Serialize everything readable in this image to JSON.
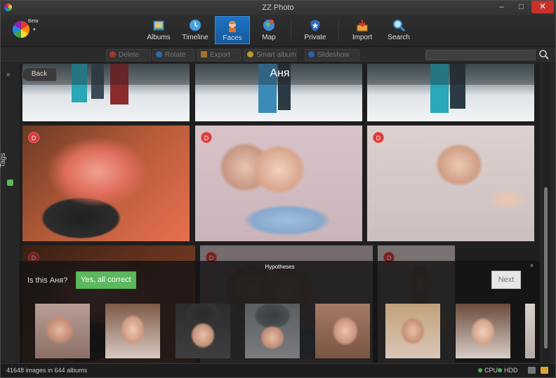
{
  "window": {
    "title": "ZZ Photo",
    "minimize_glyph": "–",
    "maximize_glyph": "□",
    "close_glyph": "✕"
  },
  "logo": {
    "badge": "Beta",
    "caret": "▾"
  },
  "nav": [
    {
      "label": "Albums",
      "icon": "albums-icon"
    },
    {
      "label": "Timeline",
      "icon": "timeline-icon"
    },
    {
      "label": "Faces",
      "icon": "faces-icon",
      "active": true
    },
    {
      "label": "Map",
      "icon": "map-icon"
    },
    {
      "label": "Private",
      "icon": "private-icon"
    },
    {
      "label": "Import",
      "icon": "import-icon"
    },
    {
      "label": "Search",
      "icon": "search-icon"
    }
  ],
  "actions": [
    {
      "label": "Delete",
      "icon": "delete-icon",
      "color": "#c0392b"
    },
    {
      "label": "Rotate",
      "icon": "rotate-icon",
      "color": "#2a7bc0"
    },
    {
      "label": "Export",
      "icon": "export-icon",
      "color": "#c07a2a"
    },
    {
      "label": "Smart album",
      "icon": "smart-album-icon",
      "color": "#c8a12a"
    },
    {
      "label": "Slideshow",
      "icon": "slideshow-icon",
      "color": "#2a6bc0"
    }
  ],
  "search": {
    "placeholder": ""
  },
  "sidebar": {
    "tags_label": "Tags",
    "expand_glyph": "»"
  },
  "view": {
    "back_label": "Back",
    "person_name": "Аня",
    "badge_letter": "D"
  },
  "hypotheses": {
    "title": "Hypotheses",
    "collapse_glyph": "»",
    "question": "Is this Аня?",
    "confirm_label": "Yes, all correct",
    "next_label": "Next"
  },
  "status": {
    "summary": "41648 images in 644 albums",
    "cpu": "CPU",
    "hdd": "HDD"
  },
  "colors": {
    "accent": "#1e74c6",
    "confirm": "#5cb85c",
    "badge": "#d83a3a",
    "indicator": "#4caf50"
  }
}
